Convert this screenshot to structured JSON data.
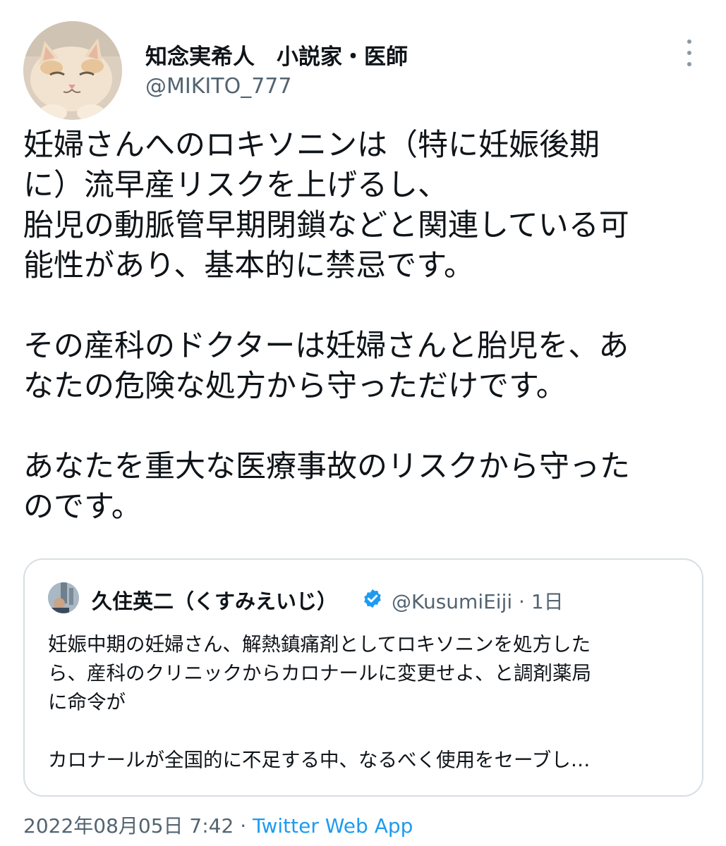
{
  "author": {
    "display_name": "知念実希人　小説家・医師",
    "handle": "@MIKITO_777",
    "avatar": "cat-avatar"
  },
  "tweet": {
    "paragraphs": [
      [
        "妊婦さんへのロキソニンは（特に妊娠後期",
        "に）流早産リスクを上げるし、",
        "胎児の動脈管早期閉鎖などと関連している可",
        "能性があり、基本的に禁忌です。"
      ],
      [
        "その産科のドクターは妊婦さんと胎児を、あ",
        "なたの危険な処方から守っただけです。"
      ],
      [
        "あなたを重大な医療事故のリスクから守った",
        "のです。"
      ]
    ]
  },
  "quoted": {
    "display_name": "久住英二（くすみえいじ）",
    "verified": true,
    "handle": "@KusumiEiji",
    "time": "· 1日",
    "paragraphs": [
      [
        "妊娠中期の妊婦さん、解熱鎮痛剤としてロキソニンを処方した",
        "ら、産科のクリニックからカロナールに変更せよ、と調剤薬局",
        "に命令が"
      ],
      [
        "カロナールが全国的に不足する中、なるべく使用をセーブし…"
      ]
    ]
  },
  "footer": {
    "timestamp": "2022年08月05日 7:42",
    "separator": " · ",
    "source": "Twitter Web App"
  },
  "colors": {
    "text": "#0f1419",
    "secondary": "#536471",
    "link": "#1d9bf0",
    "border": "#d7dee3"
  }
}
